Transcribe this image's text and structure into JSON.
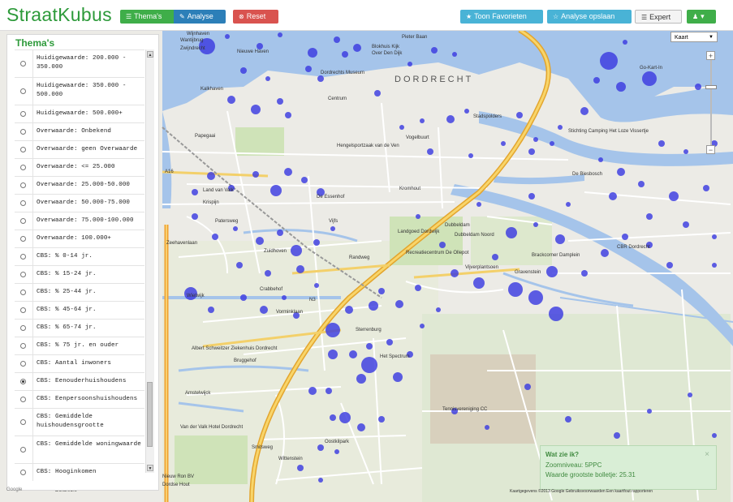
{
  "brand": "StraatKubus",
  "toolbar": {
    "thema": "Thema's",
    "analyse": "Analyse",
    "reset": "Reset",
    "favorieten": "Toon Favorieten",
    "opslaan": "Analyse opslaan",
    "expert": "Expert",
    "user_caret": "▾"
  },
  "icons": {
    "thema": "list-icon",
    "analyse": "edit-icon",
    "reset": "remove-icon",
    "favorieten": "star-icon",
    "opslaan": "star-outline-icon",
    "expert": "list-icon",
    "user": "user-icon"
  },
  "panel": {
    "title": "Thema's",
    "selected_index": 17,
    "items": [
      {
        "label": "Huidigewaarde: 200.000 - 350.000"
      },
      {
        "label": "Huidigewaarde: 350.000 - 500.000"
      },
      {
        "label": "Huidigewaarde: 500.000+"
      },
      {
        "label": "Overwaarde: Onbekend"
      },
      {
        "label": "Overwaarde: geen Overwaarde"
      },
      {
        "label": "Overwaarde: <= 25.000"
      },
      {
        "label": "Overwaarde: 25.000-50.000"
      },
      {
        "label": "Overwaarde: 50.000-75.000"
      },
      {
        "label": "Overwaarde: 75.000-100.000"
      },
      {
        "label": "Overwaarde: 100.000+"
      },
      {
        "label": "CBS: % 0-14 jr."
      },
      {
        "label": "CBS: % 15-24 jr."
      },
      {
        "label": "CBS: % 25-44 jr."
      },
      {
        "label": "CBS: % 45-64 jr."
      },
      {
        "label": "CBS: % 65-74 jr."
      },
      {
        "label": "CBS: % 75 jr. en ouder"
      },
      {
        "label": "CBS: Aantal inwoners"
      },
      {
        "label": "CBS: Eenouderhuishoudens"
      },
      {
        "label": "CBS: Eenpersoonshuishoudens"
      },
      {
        "label": "CBS: Gemiddelde huishoudensgrootte"
      },
      {
        "label": "CBS: Gemiddelde woningwaarde"
      },
      {
        "label": "CBS: Hooginkomen"
      }
    ]
  },
  "map": {
    "type_select": "Kaart",
    "zoom_in": "+",
    "zoom_out": "−",
    "city_label": "DORDRECHT",
    "labels": [
      "Wijnhaven",
      "Wantijbrug",
      "Zwijndrecht",
      "Nieuwe Haven",
      "Kalkhaven",
      "Dordrechts Museum",
      "Blokhuis Kijk",
      "Over Den Dijk",
      "Pieter Baan",
      "Centrum",
      "Stadspolders",
      "Papegaai",
      "Hengelsportzaak van de Ven",
      "Vogelbuurt",
      "Kromhout",
      "De Essenhof",
      "Land van Valk",
      "Krispijn",
      "Patersweg",
      "Zuidhoven",
      "Vijfs",
      "Landgoed Dordwijk",
      "Dubbeldam",
      "Recreatiecentrum De Ollepot",
      "Vijverplantsoen",
      "Gravenstein",
      "Sterrenburg",
      "Het Spectrum",
      "Zeehavenlaan",
      "Bruggehof",
      "Amstelwijck",
      "Van der Valk Hotel Dordrecht",
      "Smitsweg",
      "Wittenstein",
      "Oostkilpark",
      "Tennisvereniging CC",
      "Go-Kart-In",
      "Stichting Camping Het Loze Vissertje",
      "De Biesbosch",
      "Wielwijk",
      "Crabbehof",
      "Vorminklaan",
      "Albert Schweitzer Ziekenhuis Dordrecht",
      "CBR Dordrecht",
      "Brackcorner Damplein",
      "Dubbeldam Noord",
      "Nieuw Ron BV",
      "Dordse Hout",
      "N3",
      "Randweg",
      "A16",
      "Dordrecht"
    ]
  },
  "info_box": {
    "title": "Wat zie ik?",
    "close": "×",
    "zoom_line": "Zoomniveau: 5PPC",
    "value_line": "Waarde grootste bolletje: 25.31"
  },
  "attribution": "Kaartgegevens ©2013 Google   Gebruiksvoorwaarden   Een kaartfout rapporteren",
  "google_logo": "Google",
  "colors": {
    "brand_green": "#2d9a3a",
    "bubble": "#3b3be0",
    "water": "#a5c4ea",
    "road_yellow": "#f2c94c"
  }
}
